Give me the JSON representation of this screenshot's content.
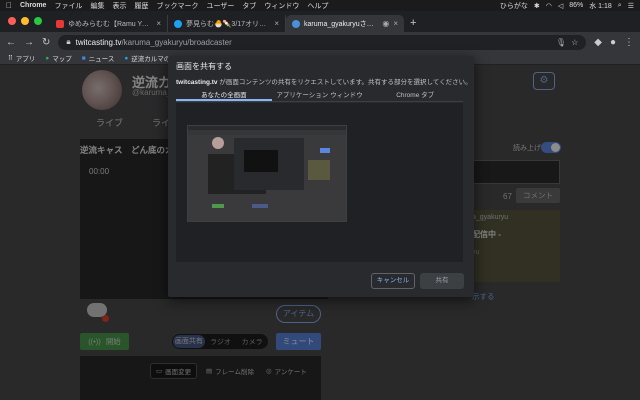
{
  "menubar": {
    "app": "Chrome",
    "items": [
      "ファイル",
      "編集",
      "表示",
      "履歴",
      "ブックマーク",
      "ユーザー",
      "タブ",
      "ウィンドウ",
      "ヘルプ"
    ],
    "ime": "ひらがな",
    "battery": "86%",
    "clock": "水 1:18"
  },
  "tabs": [
    {
      "title": "ゆめみらむむ【Ramu Yumemi】",
      "favicon_color": "#e53935"
    },
    {
      "title": "夢見らむ🐣🍡3/17オリ曲リリース",
      "favicon_color": "#1da1f2"
    },
    {
      "title": "karuma_gyakuryuさんのラ",
      "favicon_color": "#4a90d9"
    }
  ],
  "address": {
    "host": "twitcasting.tv",
    "path": "/karuma_gyakuryu/broadcaster"
  },
  "bookmarks": [
    "アプリ",
    "マップ",
    "ニュース",
    "逆流カルマの"
  ],
  "page": {
    "channel_name": "逆流カル",
    "channel_id": "@karuma_",
    "nav": [
      "ライブ",
      "ライ"
    ],
    "stream_title": "逆流キャス　どん底のカ",
    "elapsed": "00:00",
    "read_aloud_label": "読み上げ",
    "comment_count": "67",
    "comment_button": "コメント",
    "info_user": "a_gyakuryu",
    "info_status": "配信中 -",
    "info_small": "yu",
    "more_link": "示する",
    "item_button": "アイテム",
    "start_button": "開始",
    "mode_tabs": [
      "画面共有",
      "ラジオ",
      "カメラ"
    ],
    "mute_button": "ミュート",
    "controls": [
      "画面変更",
      "フレーム削除",
      "アンケート"
    ]
  },
  "dialog": {
    "title": "画面を共有する",
    "desc_site": "twitcasting.tv",
    "desc_text": "が画面コンテンツの共有をリクエストしています。共有する部分を選択してください。",
    "tabs": [
      "あなたの全画面",
      "アプリケーション ウィンドウ",
      "Chrome タブ"
    ],
    "cancel": "キャンセル",
    "share": "共有"
  }
}
